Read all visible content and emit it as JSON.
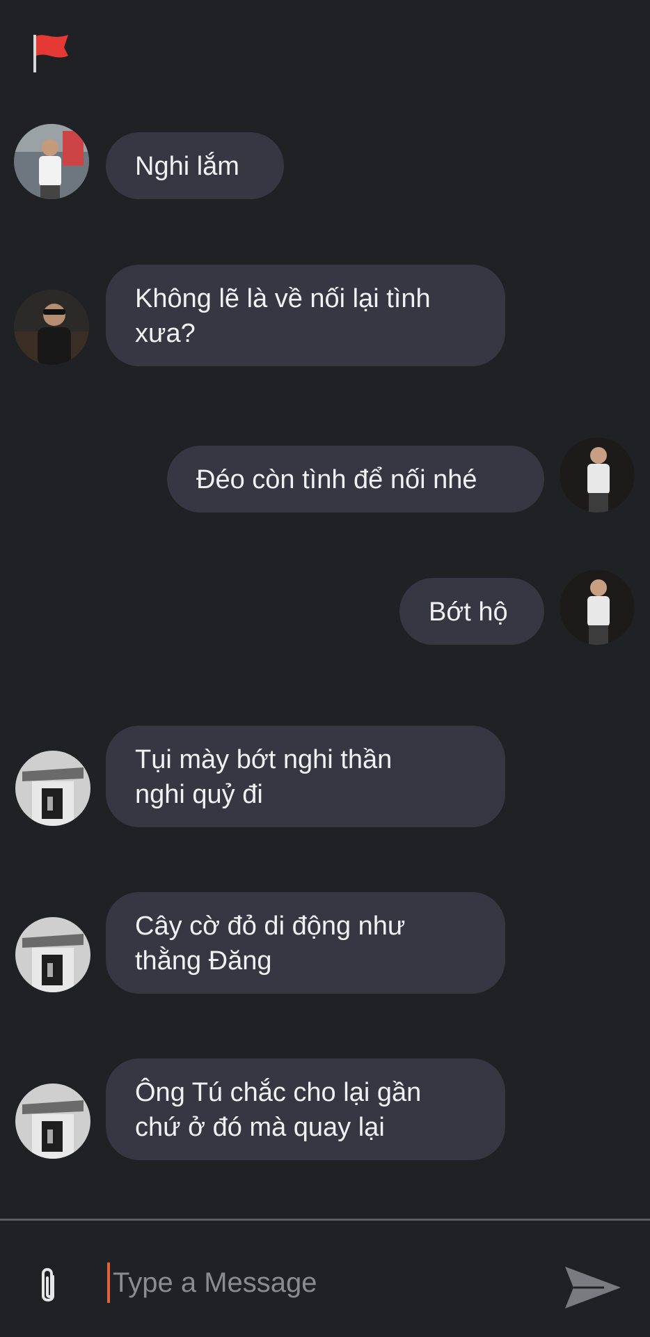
{
  "header": {
    "flag_icon": "red-flag-icon",
    "flag_color": "#e53935"
  },
  "messages": [
    {
      "side": "left",
      "avatar": "man-white-shirt",
      "lines": [
        "Nghi lắm"
      ]
    },
    {
      "side": "left",
      "avatar": "man-sunglasses",
      "lines": [
        "Không lẽ là về nối lại tình",
        "xưa?"
      ]
    },
    {
      "side": "right",
      "avatar": "man-standing",
      "lines": [
        "Đéo còn tình để nối nhé"
      ]
    },
    {
      "side": "right",
      "avatar": "man-standing",
      "lines": [
        "Bớt hộ"
      ]
    },
    {
      "side": "left",
      "avatar": "building-window",
      "lines": [
        "Tụi mày bớt nghi thần",
        "nghi quỷ đi"
      ]
    },
    {
      "side": "left",
      "avatar": "building-window",
      "lines": [
        "Cây cờ đỏ di động như",
        "thằng Đăng"
      ]
    },
    {
      "side": "left",
      "avatar": "building-window",
      "lines": [
        "Ông Tú chắc cho lại gần",
        "chứ ở đó mà quay lại"
      ]
    }
  ],
  "composer": {
    "placeholder": "Type a Message",
    "value": "",
    "attach_icon": "paperclip-icon",
    "send_icon": "send-icon",
    "caret_color": "#e2623a"
  },
  "colors": {
    "background": "#202124",
    "bubble": "#363742",
    "text": "#f1f1f4"
  }
}
